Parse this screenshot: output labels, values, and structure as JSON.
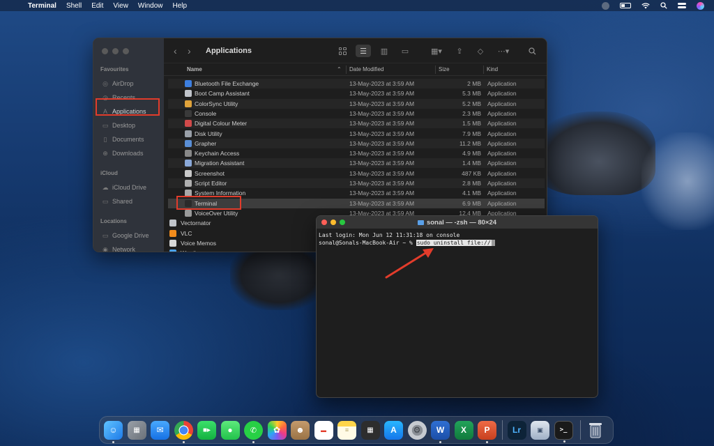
{
  "menubar": {
    "app_name": "Terminal",
    "items": [
      "Shell",
      "Edit",
      "View",
      "Window",
      "Help"
    ]
  },
  "finder": {
    "title": "Applications",
    "sidebar": {
      "favourites_header": "Favourites",
      "favourites": [
        "AirDrop",
        "Recents",
        "Applications",
        "Desktop",
        "Documents",
        "Downloads"
      ],
      "icloud_header": "iCloud",
      "icloud": [
        "iCloud Drive",
        "Shared"
      ],
      "locations_header": "Locations",
      "locations": [
        "Google Drive",
        "Network"
      ]
    },
    "columns": {
      "name": "Name",
      "date": "Date Modified",
      "size": "Size",
      "kind": "Kind"
    },
    "rows": [
      {
        "name": "Bluetooth File Exchange",
        "date": "13-May-2023 at 3:59 AM",
        "size": "2 MB",
        "kind": "Application"
      },
      {
        "name": "Boot Camp Assistant",
        "date": "13-May-2023 at 3:59 AM",
        "size": "5.3 MB",
        "kind": "Application"
      },
      {
        "name": "ColorSync Utility",
        "date": "13-May-2023 at 3:59 AM",
        "size": "5.2 MB",
        "kind": "Application"
      },
      {
        "name": "Console",
        "date": "13-May-2023 at 3:59 AM",
        "size": "2.3 MB",
        "kind": "Application"
      },
      {
        "name": "Digital Colour Meter",
        "date": "13-May-2023 at 3:59 AM",
        "size": "1.5 MB",
        "kind": "Application"
      },
      {
        "name": "Disk Utility",
        "date": "13-May-2023 at 3:59 AM",
        "size": "7.9 MB",
        "kind": "Application"
      },
      {
        "name": "Grapher",
        "date": "13-May-2023 at 3:59 AM",
        "size": "11.2 MB",
        "kind": "Application"
      },
      {
        "name": "Keychain Access",
        "date": "13-May-2023 at 3:59 AM",
        "size": "4.9 MB",
        "kind": "Application"
      },
      {
        "name": "Migration Assistant",
        "date": "13-May-2023 at 3:59 AM",
        "size": "1.4 MB",
        "kind": "Application"
      },
      {
        "name": "Screenshot",
        "date": "13-May-2023 at 3:59 AM",
        "size": "487 KB",
        "kind": "Application"
      },
      {
        "name": "Script Editor",
        "date": "13-May-2023 at 3:59 AM",
        "size": "2.8 MB",
        "kind": "Application"
      },
      {
        "name": "System Information",
        "date": "13-May-2023 at 3:59 AM",
        "size": "4.1 MB",
        "kind": "Application"
      },
      {
        "name": "Terminal",
        "date": "13-May-2023 at 3:59 AM",
        "size": "6.9 MB",
        "kind": "Application"
      },
      {
        "name": "VoiceOver Utility",
        "date": "13-May-2023 at 3:59 AM",
        "size": "12.4 MB",
        "kind": "Application"
      }
    ],
    "outer_rows": [
      "Vectornator",
      "VLC",
      "Voice Memos",
      "Weather"
    ]
  },
  "terminal": {
    "title": "sonal — -zsh — 80×24",
    "last_login": "Last login: Mon Jun 12 11:31:18 on console",
    "prompt": "sonal@Sonals-MacBook-Air ~ % ",
    "command": "sudo uninstall file://"
  },
  "dock": {
    "lightroom_label": "Lr",
    "word_label": "W",
    "excel_label": "X",
    "powerpoint_label": "P",
    "terminal_label": ">_"
  },
  "colors": {
    "highlight": "#e23c2b",
    "accent_blue": "#5aa0e8"
  }
}
